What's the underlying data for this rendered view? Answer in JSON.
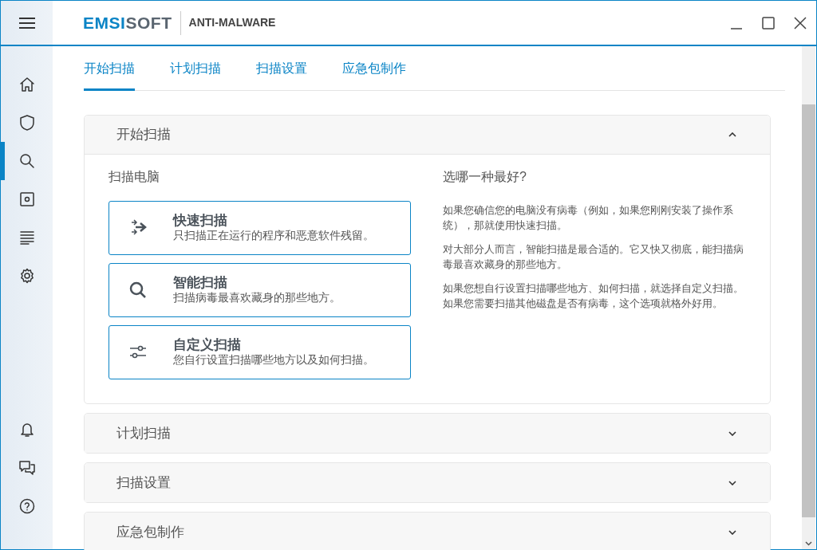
{
  "logo": {
    "blue_part": "EMSI",
    "grey_part": "SOFT"
  },
  "product": "ANTI-MALWARE",
  "sidebar": {
    "items": [
      {
        "selected": false
      },
      {
        "selected": false
      },
      {
        "selected": true
      },
      {
        "selected": false
      },
      {
        "selected": false
      },
      {
        "selected": false
      }
    ]
  },
  "tabs": [
    {
      "label": "开始扫描",
      "selected": true
    },
    {
      "label": "计划扫描",
      "selected": false
    },
    {
      "label": "扫描设置",
      "selected": false
    },
    {
      "label": "应急包制作",
      "selected": false
    }
  ],
  "sections": [
    {
      "title": "开始扫描",
      "expanded": true,
      "left_heading": "扫描电脑",
      "options": [
        {
          "kind": "quick",
          "title": "快速扫描",
          "description": "只扫描正在运行的程序和恶意软件残留。"
        },
        {
          "kind": "smart",
          "title": "智能扫描",
          "description": "扫描病毒最喜欢藏身的那些地方。"
        },
        {
          "kind": "custom",
          "title": "自定义扫描",
          "description": "您自行设置扫描哪些地方以及如何扫描。"
        }
      ],
      "right_heading": "选哪一种最好?",
      "paragraphs": [
        "如果您确信您的电脑没有病毒（例如，如果您刚刚安装了操作系统），那就使用快速扫描。",
        "对大部分人而言，智能扫描是最合适的。它又快又彻底，能扫描病毒最喜欢藏身的那些地方。",
        "如果您想自行设置扫描哪些地方、如何扫描，就选择自定义扫描。如果您需要扫描其他磁盘是否有病毒，这个选项就格外好用。"
      ]
    },
    {
      "title": "计划扫描",
      "expanded": false
    },
    {
      "title": "扫描设置",
      "expanded": false
    },
    {
      "title": "应急包制作",
      "expanded": false
    }
  ]
}
